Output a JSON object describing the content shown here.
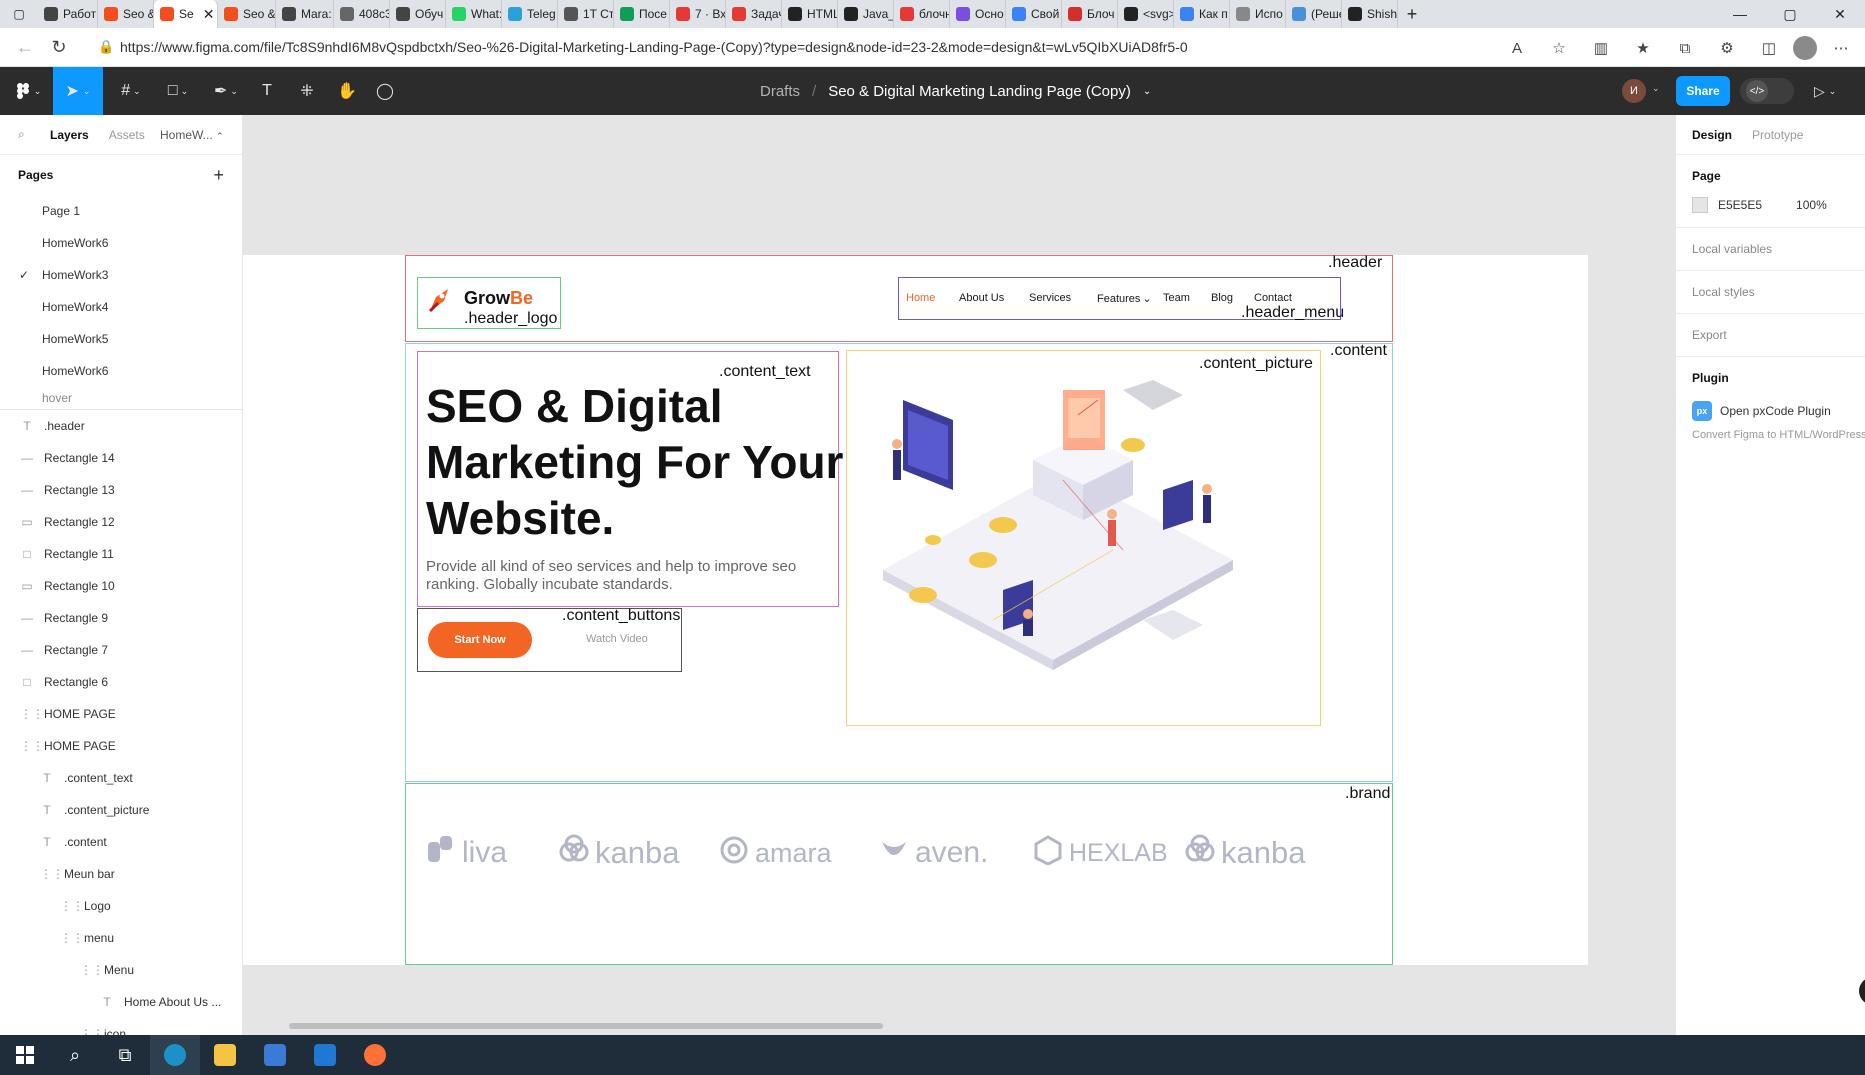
{
  "browser": {
    "tabs": [
      {
        "label": "Работ",
        "color": "#444444",
        "icon": "openai-icon"
      },
      {
        "label": "Seo &",
        "color": "#f24e1e",
        "icon": "figma-icon"
      },
      {
        "label": "Se",
        "color": "#f24e1e",
        "icon": "figma-icon",
        "active": true
      },
      {
        "label": "Seo &",
        "color": "#f24e1e",
        "icon": "figma-icon"
      },
      {
        "label": "Mara:",
        "color": "#444444",
        "icon": "openai-icon"
      },
      {
        "label": "408c3",
        "color": "#666666",
        "icon": "document-icon"
      },
      {
        "label": "Обуч",
        "color": "#444444",
        "icon": "openai-icon"
      },
      {
        "label": "What:",
        "color": "#25d366",
        "icon": "whatsapp-icon"
      },
      {
        "label": "Teleg",
        "color": "#2aa1da",
        "icon": "telegram-icon"
      },
      {
        "label": "1T Ст",
        "color": "#555555",
        "icon": "site-icon"
      },
      {
        "label": "Посе",
        "color": "#0f9d58",
        "icon": "sheets-icon"
      },
      {
        "label": "7 · Вх",
        "color": "#e53935",
        "icon": "mail-icon"
      },
      {
        "label": "Задач",
        "color": "#e53935",
        "icon": "yandex-icon"
      },
      {
        "label": "HTML",
        "color": "#222222",
        "icon": "github-icon"
      },
      {
        "label": "Java_I",
        "color": "#222222",
        "icon": "github-icon"
      },
      {
        "label": "блочн",
        "color": "#e53935",
        "icon": "yandex-icon"
      },
      {
        "label": "Осно",
        "color": "#7b4de0",
        "icon": "site-icon"
      },
      {
        "label": "Свой",
        "color": "#3b82f6",
        "icon": "site-icon"
      },
      {
        "label": "Блоч",
        "color": "#d32f2f",
        "icon": "stop-icon"
      },
      {
        "label": "<svg>",
        "color": "#222222",
        "icon": "site-icon"
      },
      {
        "label": "Как п",
        "color": "#3b82f6",
        "icon": "site-icon"
      },
      {
        "label": "Испо",
        "color": "#888888",
        "icon": "shield-icon"
      },
      {
        "label": "(Реше",
        "color": "#4a90d9",
        "icon": "site-icon"
      },
      {
        "label": "Shishi",
        "color": "#222222",
        "icon": "github-icon"
      }
    ],
    "url": "https://www.figma.com/file/Tc8S9nhdI6M8vQspdbctxh/Seo-%26-Digital-Marketing-Landing-Page-(Copy)?type=design&node-id=23-2&mode=design&t=wLv5QIbXUiAD8fr5-0"
  },
  "figma": {
    "breadcrumb_drafts": "Drafts",
    "breadcrumb_sep": "/",
    "file_name": "Seo & Digital Marketing Landing Page (Copy)",
    "user_initial": "И",
    "share_label": "Share"
  },
  "left_panel": {
    "tab_layers": "Layers",
    "tab_assets": "Assets",
    "current_page": "HomeW...",
    "pages_title": "Pages",
    "pages": [
      "Page 1",
      "HomeWork6",
      "HomeWork3",
      "HomeWork4",
      "HomeWork5",
      "HomeWork6"
    ],
    "selected_page_index": 2,
    "cut_page": "hover",
    "layers": [
      {
        "name": ".header",
        "icon": "T",
        "indent": 0
      },
      {
        "name": "Rectangle 14",
        "icon": "—",
        "indent": 0
      },
      {
        "name": "Rectangle 13",
        "icon": "—",
        "indent": 0
      },
      {
        "name": "Rectangle 12",
        "icon": "▭",
        "indent": 0
      },
      {
        "name": "Rectangle 11",
        "icon": "□",
        "indent": 0
      },
      {
        "name": "Rectangle 10",
        "icon": "▭",
        "indent": 0
      },
      {
        "name": "Rectangle 9",
        "icon": "—",
        "indent": 0
      },
      {
        "name": "Rectangle 7",
        "icon": "—",
        "indent": 0
      },
      {
        "name": "Rectangle 6",
        "icon": "□",
        "indent": 0
      },
      {
        "name": "HOME PAGE",
        "icon": "⋮⋮",
        "indent": 0
      },
      {
        "name": "HOME PAGE",
        "icon": "⋮⋮",
        "indent": 0
      },
      {
        "name": ".content_text",
        "icon": "T",
        "indent": 1
      },
      {
        "name": ".content_picture",
        "icon": "T",
        "indent": 1
      },
      {
        "name": ".content",
        "icon": "T",
        "indent": 1
      },
      {
        "name": "Meun bar",
        "icon": "⋮⋮",
        "indent": 1
      },
      {
        "name": "Logo",
        "icon": "⋮⋮",
        "indent": 2
      },
      {
        "name": "menu",
        "icon": "⋮⋮",
        "indent": 2
      },
      {
        "name": "Menu",
        "icon": "⋮⋮",
        "indent": 3
      },
      {
        "name": "Home About Us ...",
        "icon": "T",
        "indent": 4
      },
      {
        "name": "icon",
        "icon": "⋮⋮",
        "indent": 3
      }
    ]
  },
  "canvas": {
    "labels": {
      "header": ".header",
      "header_logo": ".header_logo",
      "header_menu": ".header_menu",
      "content": ".content",
      "content_text": ".content_text",
      "content_picture": ".content_picture",
      "content_buttons": ".content_buttons",
      "brand": ".brand"
    },
    "logo_grow": "Grow",
    "logo_be": "Be",
    "menu": [
      "Home",
      "About Us",
      "Services",
      "Features",
      "Team",
      "Blog",
      "Contact"
    ],
    "features_chevron": "⌄",
    "hero_title": "SEO & Digital Marketing For Your Website.",
    "hero_sub": "Provide all kind of seo services and help to improve seo ranking. Globally incubate standards.",
    "btn_start": "Start Now",
    "btn_watch": "Watch Video",
    "brands": [
      "liva",
      "kanba",
      "amara",
      "aven.",
      "HEXLAB",
      "kanba"
    ],
    "accent_color": "#f26522"
  },
  "right_panel": {
    "tab_design": "Design",
    "tab_prototype": "Prototype",
    "page_section": "Page",
    "page_color": "E5E5E5",
    "page_opacity": "100%",
    "local_variables": "Local variables",
    "local_styles": "Local styles",
    "export": "Export",
    "plugin_section": "Plugin",
    "plugin_badge": "px",
    "plugin_name": "Open pxCode Plugin",
    "plugin_desc": "Convert Figma to HTML/WordPress"
  }
}
